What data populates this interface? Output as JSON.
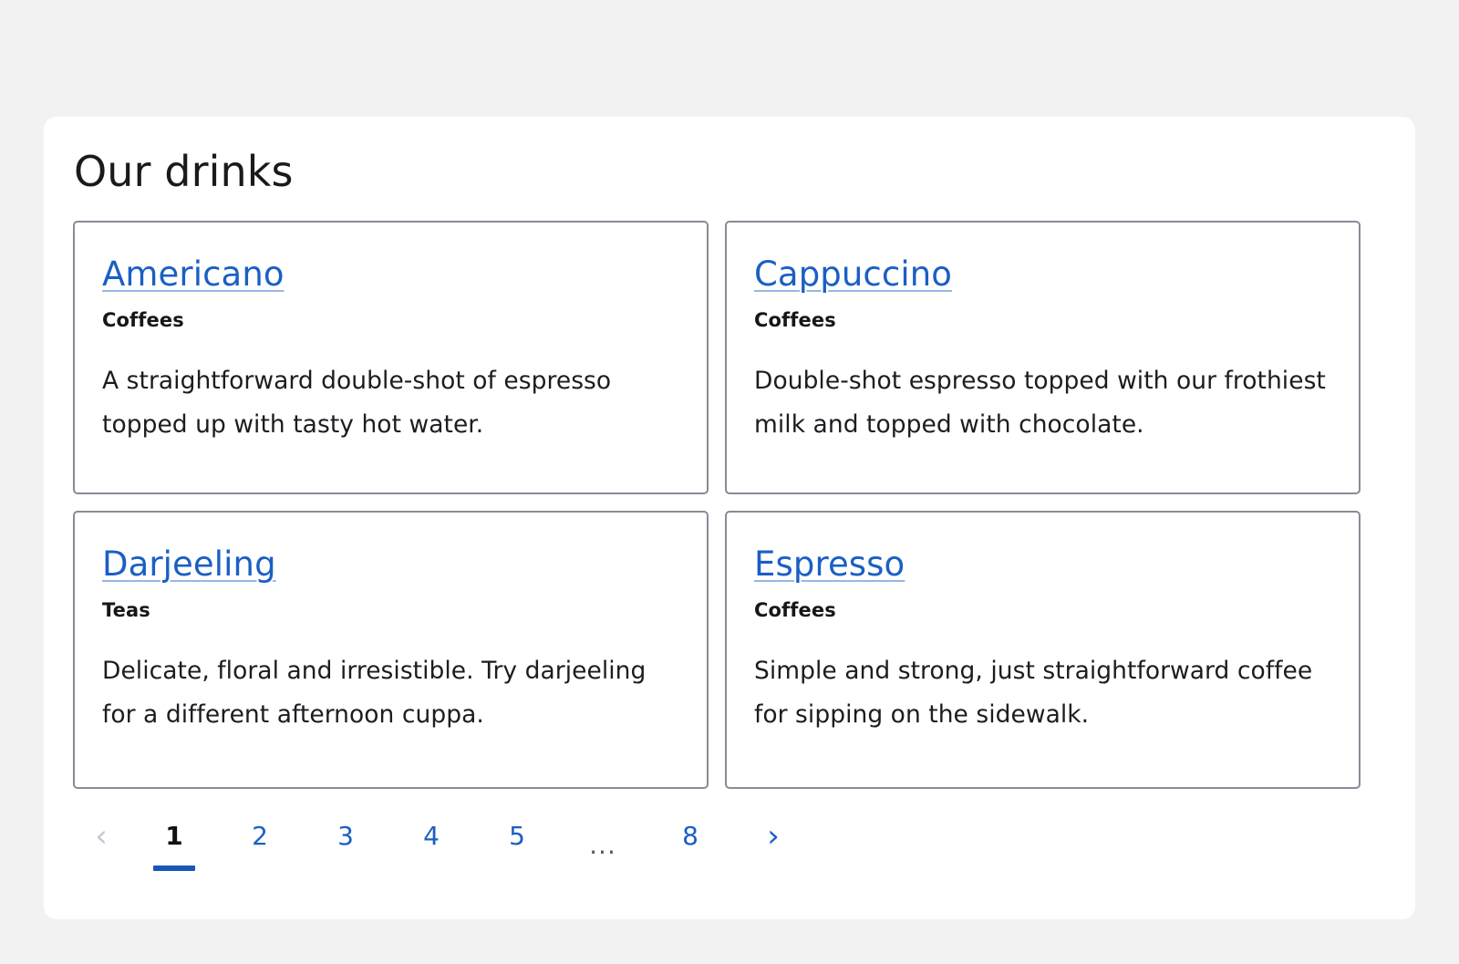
{
  "page": {
    "title": "Our drinks",
    "background_color": "#f2f2f2",
    "panel_color": "#ffffff",
    "link_color": "#1a5fc4",
    "accent_color": "#1a56b8",
    "card_border_color": "#868c96"
  },
  "cards": [
    {
      "name": "Americano",
      "category": "Coffees",
      "description": "A straightforward double-shot of espresso topped up with tasty hot water."
    },
    {
      "name": "Cappuccino",
      "category": "Coffees",
      "description": "Double-shot espresso topped with our frothiest milk and topped with chocolate."
    },
    {
      "name": "Darjeeling",
      "category": "Teas",
      "description": "Delicate, floral and irresistible. Try darjeeling for a different afternoon cuppa."
    },
    {
      "name": "Espresso",
      "category": "Coffees",
      "description": "Simple and strong, just straightforward coffee for sipping on the sidewalk."
    }
  ],
  "pagination": {
    "prev_icon": "‹",
    "next_icon": "›",
    "ellipsis": "...",
    "current_page": "1",
    "pages": [
      "1",
      "2",
      "3",
      "4",
      "5",
      "8"
    ],
    "page_2": "2",
    "page_3": "3",
    "page_4": "4",
    "page_5": "5",
    "page_last": "8"
  }
}
